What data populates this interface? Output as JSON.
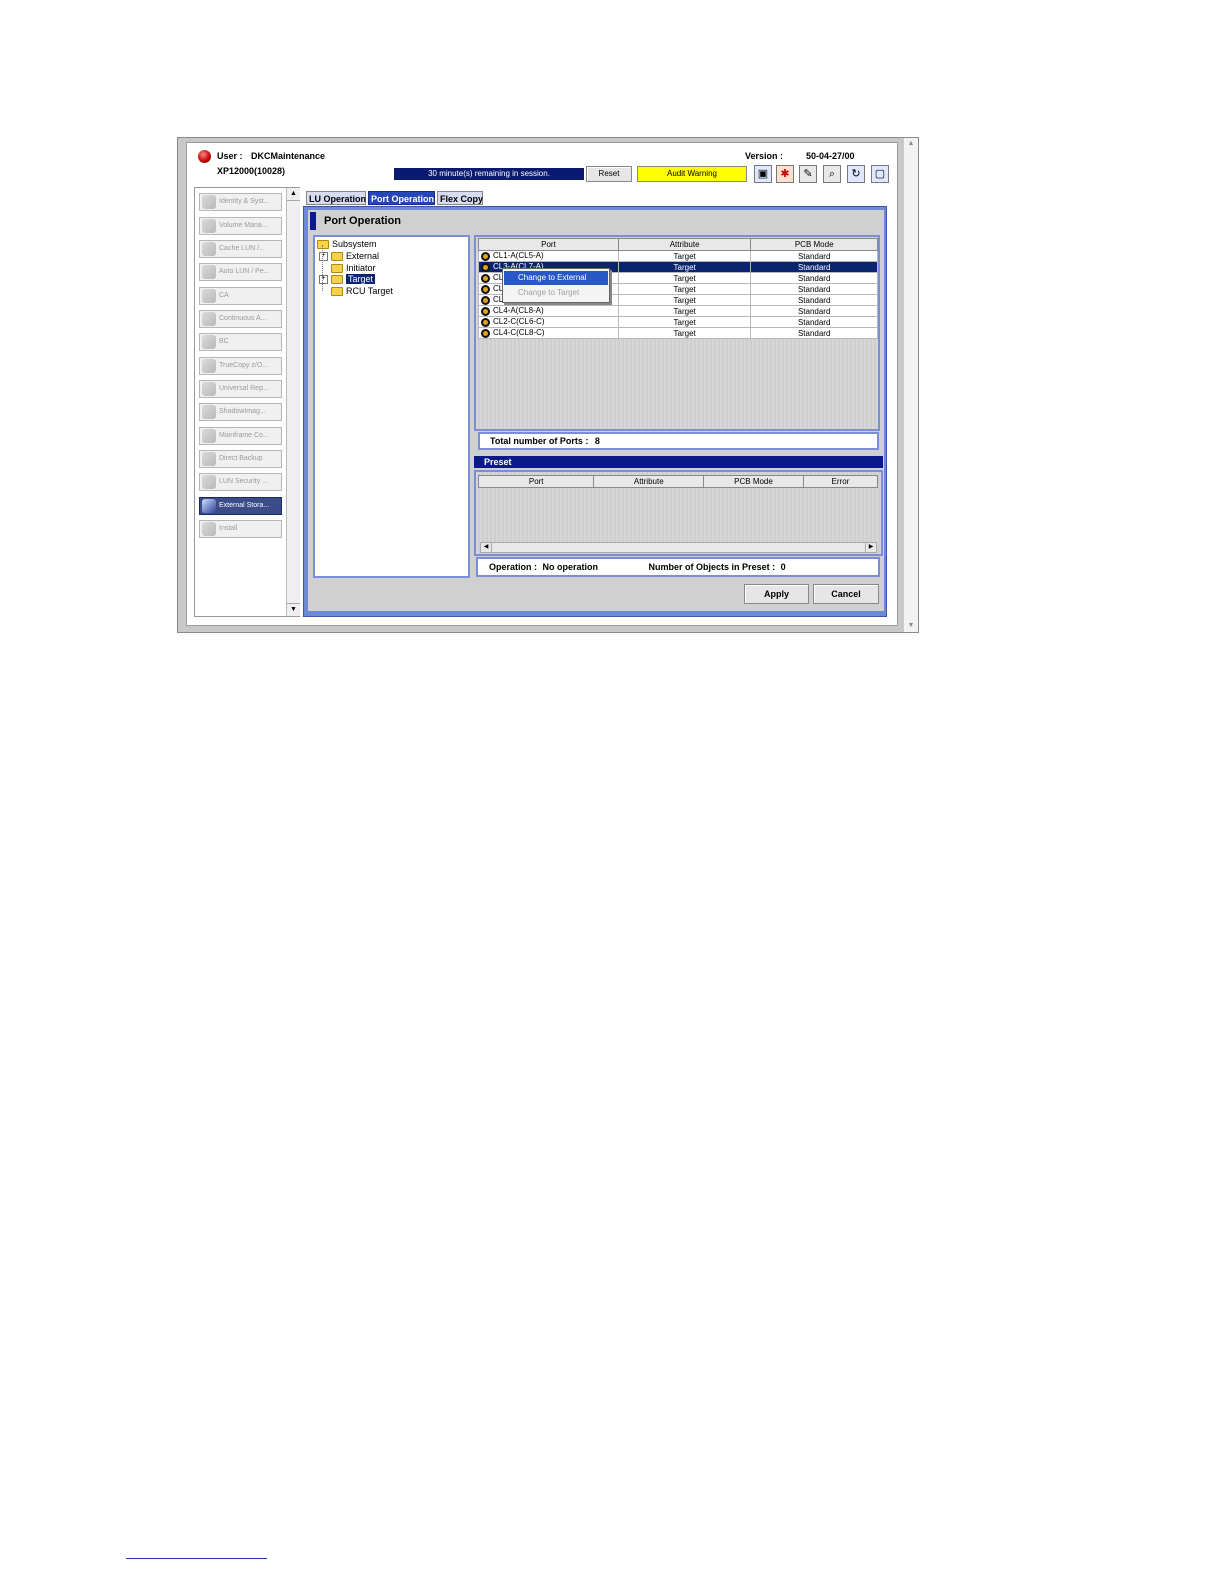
{
  "header": {
    "user_label": "User :",
    "user_name": "DKCMaintenance",
    "system_name": "XP12000(10028)",
    "version_label": "Version :",
    "version_value": "50-04-27/00",
    "session_text": "30 minute(s) remaining in session.",
    "reset_label": "Reset",
    "audit_label": "Audit Warning",
    "toolbar_icons": [
      "help-icon",
      "alert-icon",
      "pen-icon",
      "search-icon",
      "refresh-icon",
      "window-icon"
    ]
  },
  "nav": {
    "items": [
      {
        "label": "Identity & Syst..."
      },
      {
        "label": "Volume Mana..."
      },
      {
        "label": "Cache LUN /..."
      },
      {
        "label": "Auto LUN / Pe..."
      },
      {
        "label": "CA"
      },
      {
        "label": "Continuous A..."
      },
      {
        "label": "BC"
      },
      {
        "label": "TrueCopy z/O..."
      },
      {
        "label": "Universal Rep..."
      },
      {
        "label": "ShadowImag..."
      },
      {
        "label": "Mainframe Co..."
      },
      {
        "label": "Direct Backup"
      },
      {
        "label": "LUN Security ..."
      },
      {
        "label": "External Stora..."
      },
      {
        "label": "Install"
      }
    ],
    "active_index": 13
  },
  "tabs": [
    {
      "label": "LU Operation"
    },
    {
      "label": "Port Operation"
    },
    {
      "label": "Flex Copy"
    }
  ],
  "panel_title": "Port Operation",
  "tree": {
    "root": "Subsystem",
    "children": [
      {
        "label": "External",
        "expandable": true
      },
      {
        "label": "Initiator",
        "expandable": false
      },
      {
        "label": "Target",
        "expandable": true,
        "selected": true
      },
      {
        "label": "RCU Target",
        "expandable": false
      }
    ]
  },
  "ports_table": {
    "columns": [
      "Port",
      "Attribute",
      "PCB Mode"
    ],
    "rows": [
      {
        "port": "CL1-A(CL5-A)",
        "attribute": "Target",
        "mode": "Standard"
      },
      {
        "port": "CL3-A(CL7-A)",
        "attribute": "Target",
        "mode": "Standard",
        "selected": true
      },
      {
        "port": "CL1-C(CL5-C)",
        "attribute": "Target",
        "mode": "Standard"
      },
      {
        "port": "CL3-C(CL7-C)",
        "attribute": "Target",
        "mode": "Standard"
      },
      {
        "port": "CL2-A(CL6-A)",
        "attribute": "Target",
        "mode": "Standard"
      },
      {
        "port": "CL4-A(CL8-A)",
        "attribute": "Target",
        "mode": "Standard"
      },
      {
        "port": "CL2-C(CL6-C)",
        "attribute": "Target",
        "mode": "Standard"
      },
      {
        "port": "CL4-C(CL8-C)",
        "attribute": "Target",
        "mode": "Standard"
      }
    ],
    "total_label": "Total number of Ports :",
    "total_value": "8"
  },
  "context_menu": {
    "items": [
      {
        "label": "Change to External",
        "highlighted": true
      },
      {
        "label": "Change to Target",
        "disabled": true
      }
    ]
  },
  "preset": {
    "title": "Preset",
    "columns": [
      "Port",
      "Attribute",
      "PCB Mode",
      "Error"
    ],
    "operation_label": "Operation :",
    "operation_value": "No operation",
    "count_label": "Number of Objects in Preset :",
    "count_value": "0"
  },
  "buttons": {
    "apply": "Apply",
    "cancel": "Cancel"
  }
}
